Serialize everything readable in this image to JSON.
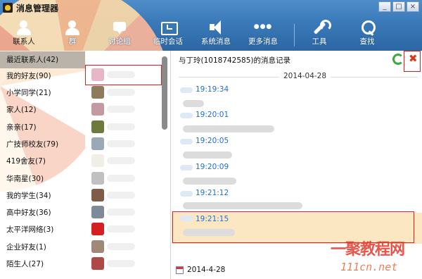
{
  "window": {
    "title": "消息管理器",
    "controls": [
      "_",
      "□",
      "×"
    ]
  },
  "toolbar": {
    "items": [
      {
        "label": "联系人",
        "icon": "person-icon",
        "active": true
      },
      {
        "label": "群",
        "icon": "group-icon"
      },
      {
        "label": "讨论组",
        "icon": "discussion-icon"
      },
      {
        "label": "临时会话",
        "icon": "temp-chat-icon"
      },
      {
        "label": "系统消息",
        "icon": "speaker-icon"
      },
      {
        "label": "更多消息",
        "icon": "more-dots-icon"
      },
      {
        "label": "工具",
        "icon": "wrench-icon"
      },
      {
        "label": "查找",
        "icon": "search-icon"
      }
    ]
  },
  "groups": [
    {
      "label": "最近联系人(42)"
    },
    {
      "label": "我的好友(90)"
    },
    {
      "label": "小学同学(21)"
    },
    {
      "label": "家人(12)"
    },
    {
      "label": "亲亲(17)"
    },
    {
      "label": "广技师校友(79)"
    },
    {
      "label": "419舍友(7)"
    },
    {
      "label": "华南星(30)"
    },
    {
      "label": "我的学生(34)"
    },
    {
      "label": "高中好友(36)"
    },
    {
      "label": "太平洋网络(3)"
    },
    {
      "label": "企业好友(1)"
    },
    {
      "label": "陌生人(27)"
    }
  ],
  "avatar_colors": [
    "#e7b7c8",
    "#8f7a5c",
    "#c49aa2",
    "#6c7a3c",
    "#9aa8b8",
    "#f1eee8",
    "#c0c0c0",
    "#7e5c48",
    "#7e8a9a",
    "#d42020",
    "#a08878",
    "#b04848",
    "#5a6ab8"
  ],
  "message_pane": {
    "title": "与丁玲(1018742585)的消息记录",
    "date_header": "2014-04-28",
    "messages": [
      {
        "time": "19:19:34"
      },
      {
        "time": "19:20:01"
      },
      {
        "time": "19:20:05"
      },
      {
        "time": "19:20:09"
      },
      {
        "time": "19:21:12"
      },
      {
        "time": "19:21:15",
        "highlighted": true
      }
    ],
    "footer_date": "2014-4-28"
  },
  "watermark": {
    "main": "一聚教程网",
    "sub": "111cn.net"
  },
  "colors": {
    "banner": "#3a79b8",
    "time_blue": "#1f6fd1",
    "highlight": "#fce7c3",
    "annotation_red": "#d81e1e"
  }
}
